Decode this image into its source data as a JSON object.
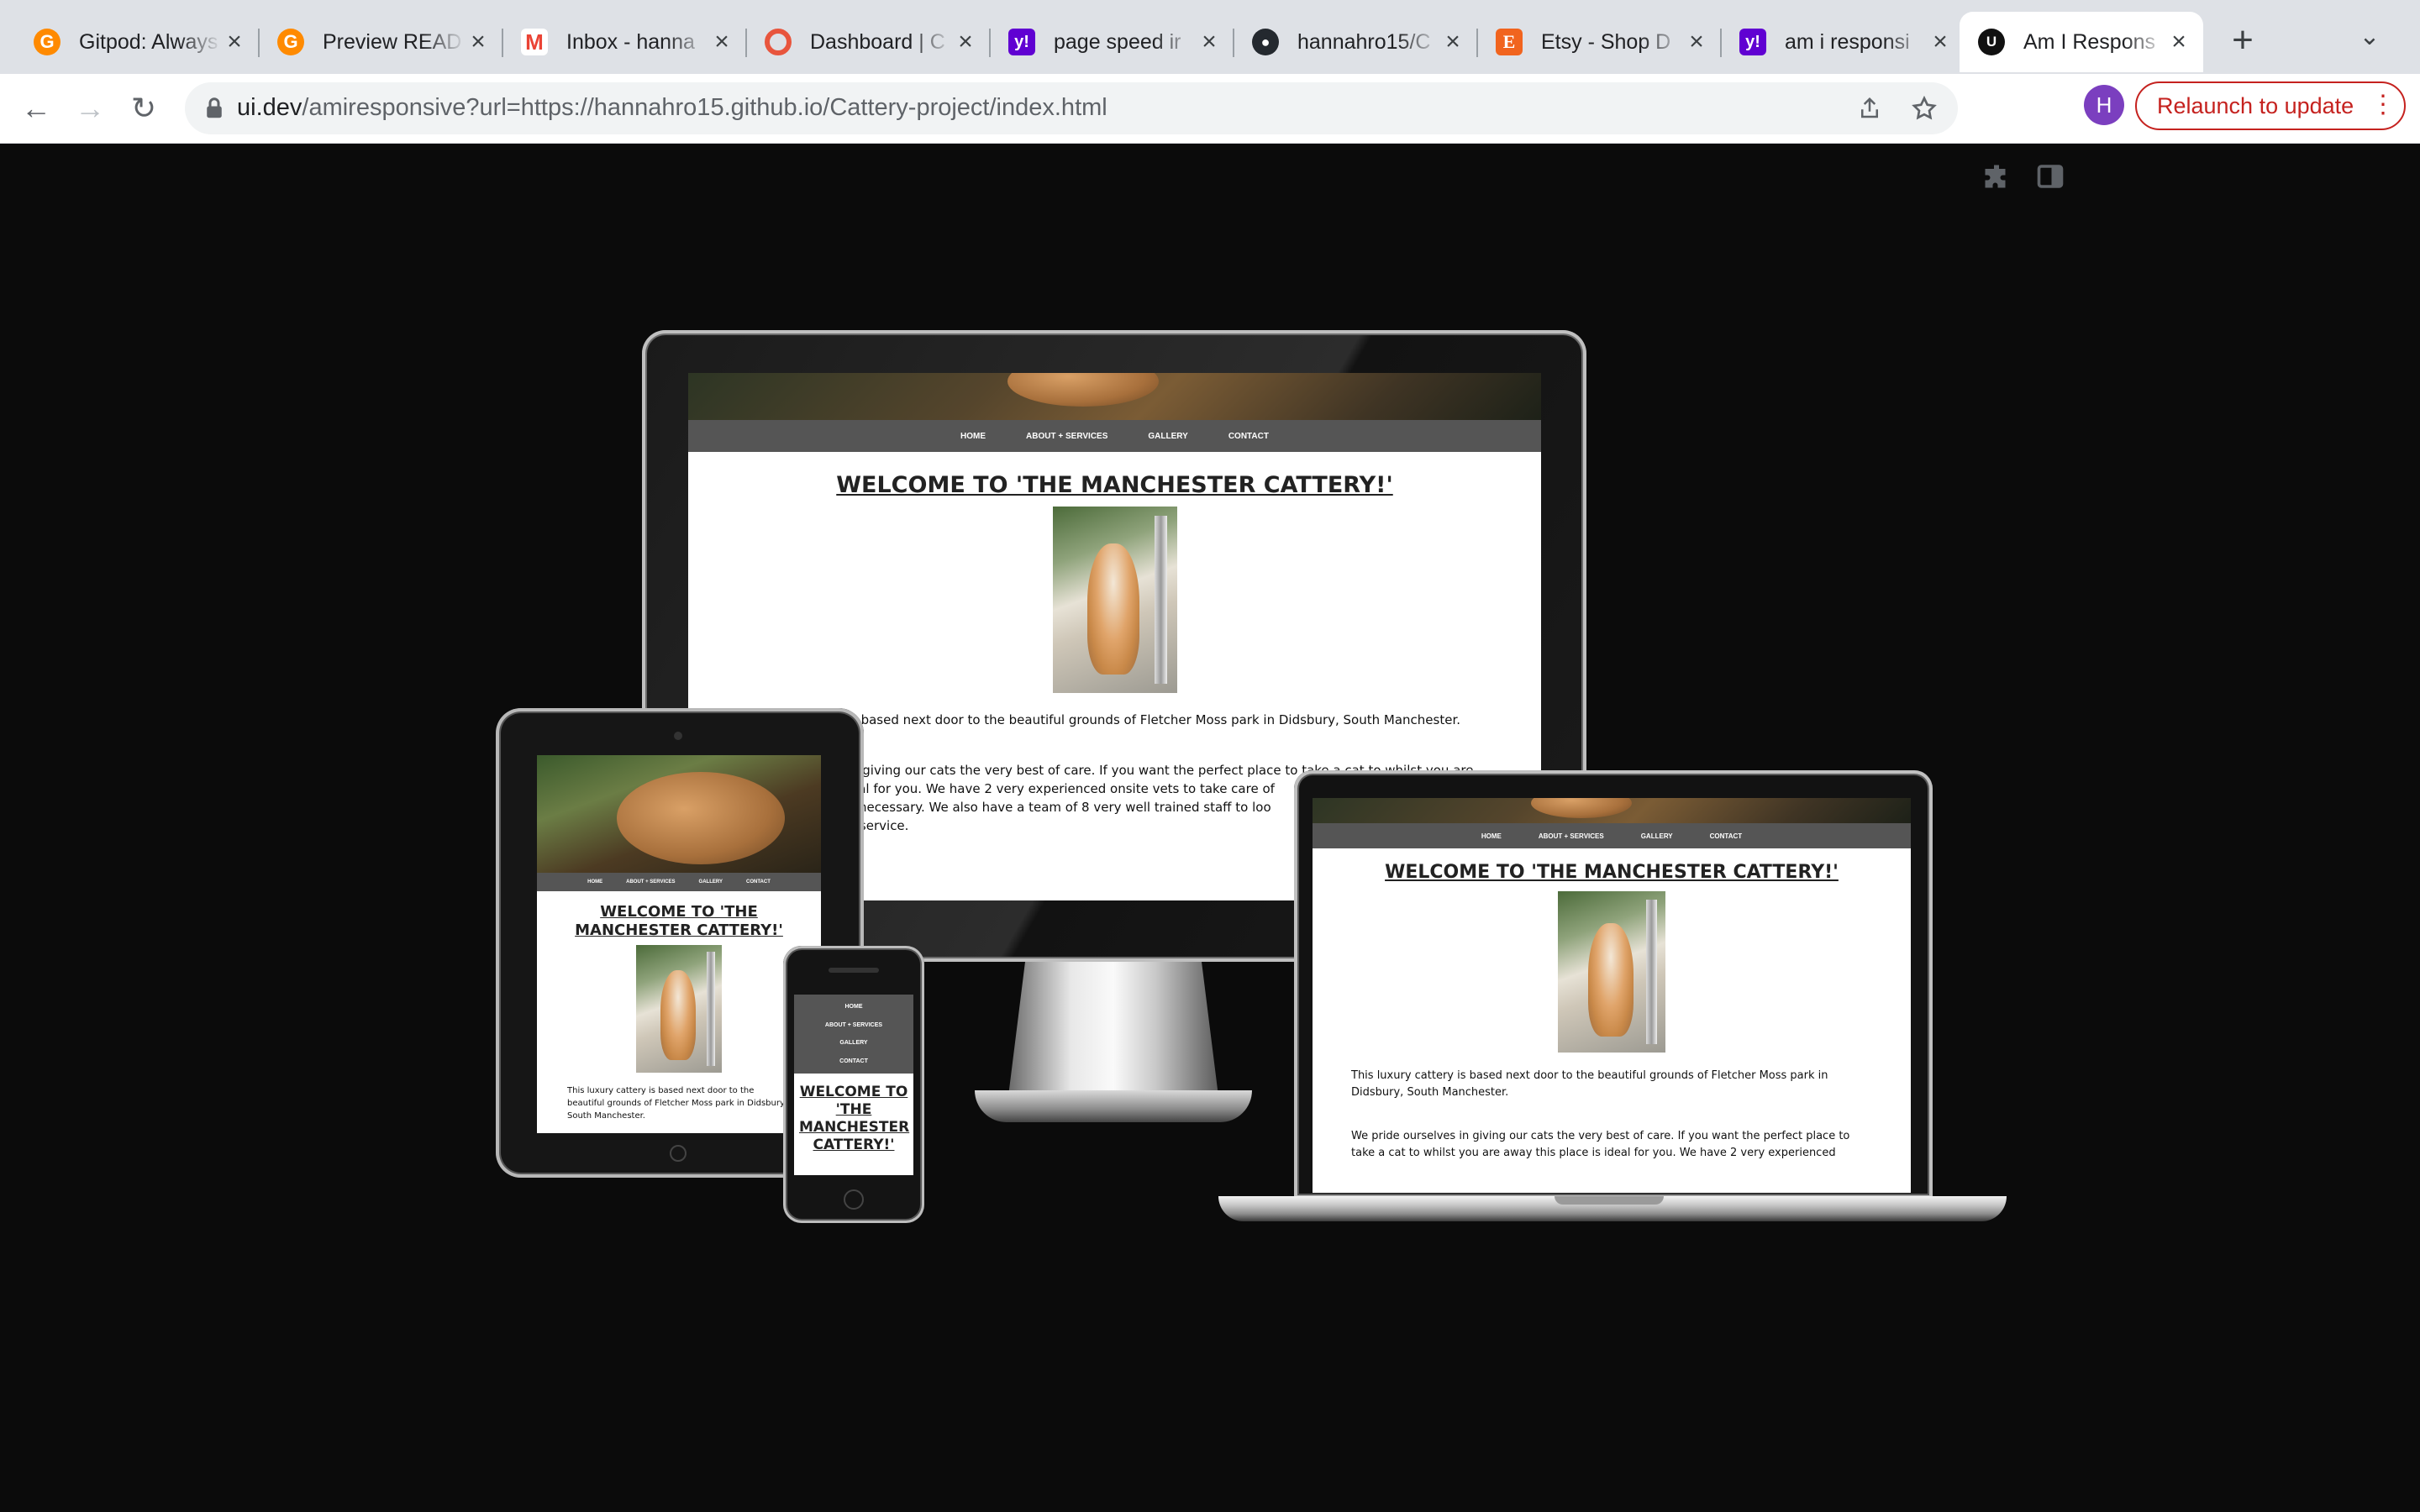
{
  "browser": {
    "tabs": [
      {
        "title": "Gitpod: Always",
        "icon": "gitpod-icon"
      },
      {
        "title": "Preview READ",
        "icon": "gitpod-icon"
      },
      {
        "title": "Inbox - hanna",
        "icon": "gmail-icon"
      },
      {
        "title": "Dashboard | C",
        "icon": "dashboard-icon"
      },
      {
        "title": "page speed ir",
        "icon": "yahoo-icon"
      },
      {
        "title": "hannahro15/C",
        "icon": "github-icon"
      },
      {
        "title": "Etsy - Shop D",
        "icon": "etsy-icon"
      },
      {
        "title": "am i responsi",
        "icon": "yahoo-icon"
      },
      {
        "title": "Am I Respons",
        "icon": "uidev-icon",
        "active": true
      }
    ],
    "url_host": "ui.dev",
    "url_path": "/amiresponsive?url=https://hannahro15.github.io/Cattery-project/index.html",
    "profile_initial": "H",
    "relaunch_label": "Relaunch to update",
    "colors": {
      "tabstrip": "#dee1e6",
      "relaunch": "#c5221f",
      "avatar": "#7b3fbf",
      "page_bg": "#0b0b0b"
    }
  },
  "site": {
    "nav": [
      "HOME",
      "ABOUT + SERVICES",
      "GALLERY",
      "CONTACT"
    ],
    "welcome": "WELCOME TO 'THE MANCHESTER CATTERY!'",
    "desktop_p1": "s based next door to the beautiful grounds of Fletcher Moss park in Didsbury, South Manchester.",
    "desktop_p2_l1": "n giving our cats the very best of care. If you want the perfect place to take a cat to whilst you are",
    "desktop_p2_l2": "eal for you. We have 2 very experienced onsite vets to take care of",
    "desktop_p2_l3": "f necessary. We also have a team of 8 very well trained staff to loo",
    "desktop_p2_l4": "r service.",
    "laptop_p1": "This luxury cattery is based next door to the beautiful grounds of Fletcher Moss park in Didsbury, South Manchester.",
    "laptop_p2": "We pride ourselves in giving our cats the very best of care. If you want the perfect place to take a cat to whilst you are away this place is ideal for you. We have 2 very experienced",
    "tablet_p1": "This luxury cattery is based next door to the beautiful grounds of Fletcher Moss park in Didsbury, South Manchester.",
    "phone_welcome": "WELCOME TO 'THE MANCHESTER CATTERY!'"
  }
}
